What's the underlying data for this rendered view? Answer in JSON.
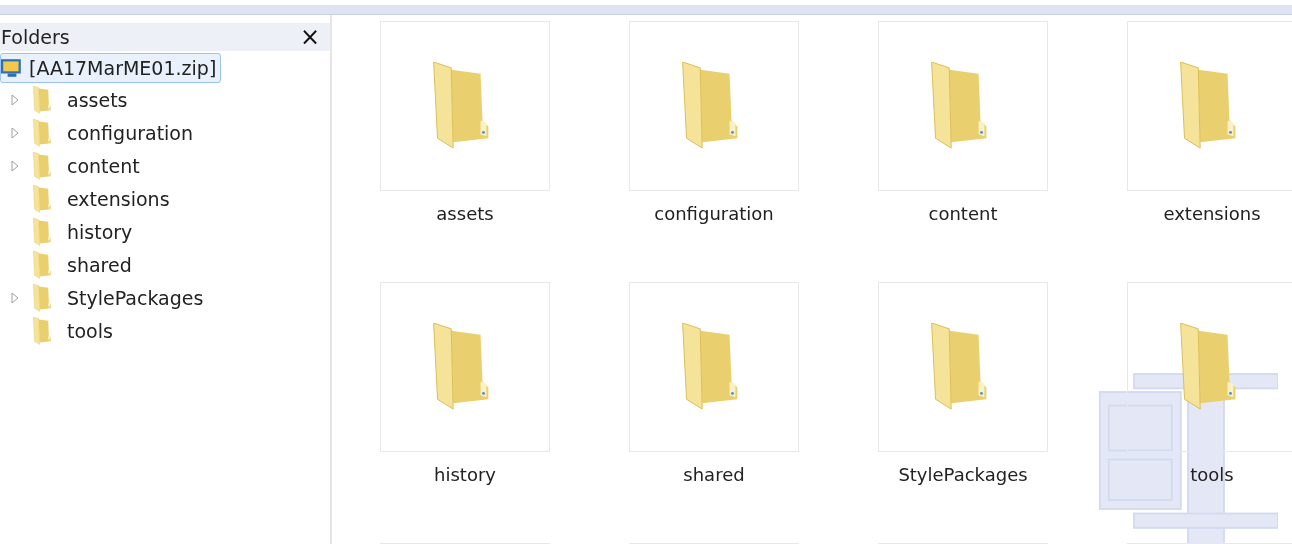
{
  "folders_pane": {
    "title": "Folders",
    "close": "×",
    "root": {
      "label": "[AA17MarME01.zip]",
      "selected": true
    },
    "items": [
      {
        "label": "assets",
        "expandable": true
      },
      {
        "label": "configuration",
        "expandable": true
      },
      {
        "label": "content",
        "expandable": true
      },
      {
        "label": "extensions",
        "expandable": false
      },
      {
        "label": "history",
        "expandable": false
      },
      {
        "label": "shared",
        "expandable": false
      },
      {
        "label": "StylePackages",
        "expandable": true
      },
      {
        "label": "tools",
        "expandable": false
      }
    ]
  },
  "view": {
    "items": [
      {
        "kind": "folder",
        "name": "assets"
      },
      {
        "kind": "folder",
        "name": "configuration"
      },
      {
        "kind": "folder",
        "name": "content"
      },
      {
        "kind": "folder",
        "name": "extensions"
      },
      {
        "kind": "folder",
        "name": "history"
      },
      {
        "kind": "folder",
        "name": "shared"
      },
      {
        "kind": "folder",
        "name": "StylePackages"
      },
      {
        "kind": "folder",
        "name": "tools"
      },
      {
        "kind": "tile"
      },
      {
        "kind": "tile"
      },
      {
        "kind": "tile"
      },
      {
        "kind": "tile"
      }
    ]
  }
}
